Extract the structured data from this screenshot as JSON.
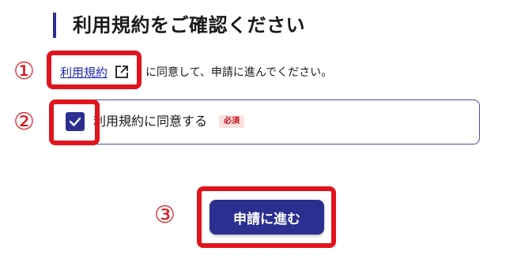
{
  "heading": {
    "title": "利用規約をご確認ください"
  },
  "terms": {
    "link_label": "利用規約",
    "suffix_text": "に同意して、申請に進んでください。"
  },
  "agreement": {
    "label": "利用規約に同意する",
    "required_badge": "必須",
    "checked": true
  },
  "actions": {
    "next_label": "申請に進む"
  },
  "markers": {
    "step1": "①",
    "step2": "②",
    "step3": "③"
  },
  "colors": {
    "primary": "#2b2f8f",
    "link": "#1d2bb0",
    "callout": "#e0141e",
    "badge_bg": "#fbe0df",
    "badge_text": "#c3141c"
  },
  "icons": {
    "external_link": "external-link-icon",
    "checkbox": "check-icon"
  }
}
